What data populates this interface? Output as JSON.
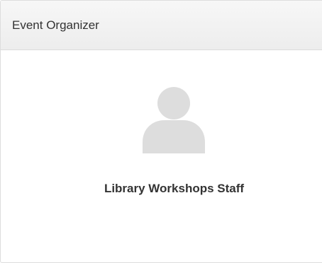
{
  "panel": {
    "title": "Event Organizer"
  },
  "organizer": {
    "avatar_icon": "user-silhouette-icon",
    "name": "Library Workshops Staff"
  },
  "colors": {
    "avatar": "#dddddd",
    "text": "#333333",
    "header_bg": "#f2f2f2",
    "border": "#dddddd"
  }
}
